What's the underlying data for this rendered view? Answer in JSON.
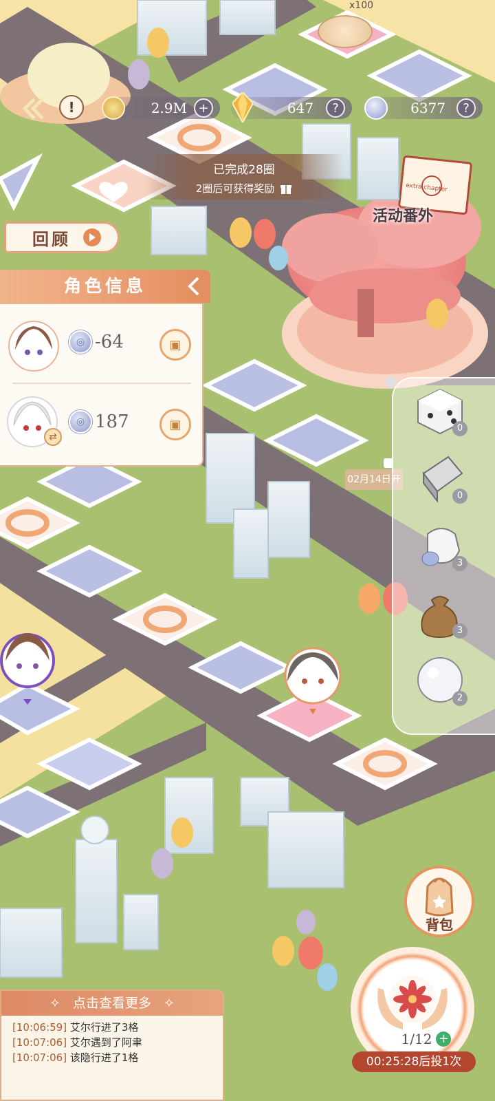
{
  "currencies": {
    "gold": {
      "value": "2.9M",
      "icon": "gold-coin-icon"
    },
    "crystal": {
      "value": "647",
      "icon": "crystal-icon"
    },
    "silver": {
      "value": "6377",
      "icon": "silver-coin-icon"
    },
    "plus_symbol": "+",
    "help_symbol": "?"
  },
  "lap_banner": {
    "completed": "已完成28圈",
    "reward_hint": "2圈后可获得奖励"
  },
  "top_reward_tile": {
    "count": "x100"
  },
  "review_button": {
    "label": "回顾"
  },
  "event_label": "活动番外",
  "event_card_text": "extra chapter",
  "character_panel": {
    "title": "角色信息",
    "rows": [
      {
        "value": "-64",
        "avatar": "brown-hair-girl-avatar"
      },
      {
        "value": "187",
        "avatar": "white-hair-boy-avatar",
        "badge": "swap-icon"
      }
    ]
  },
  "date_lock_label": "02月14日开",
  "tools": [
    {
      "name": "dice",
      "count": "0"
    },
    {
      "name": "remote-control",
      "count": "0"
    },
    {
      "name": "glove",
      "count": "3"
    },
    {
      "name": "money-sack",
      "count": "3"
    },
    {
      "name": "snowball",
      "count": "2"
    }
  ],
  "log_panel": {
    "header": "点击查看更多",
    "lines": [
      {
        "time": "[10:06:59]",
        "text": "艾尔行进了3格"
      },
      {
        "time": "[10:07:06]",
        "text": "艾尔遇到了阿聿"
      },
      {
        "time": "[10:07:06]",
        "text": "该隐行进了1格"
      }
    ]
  },
  "bag_button": {
    "label": "背包"
  },
  "roll": {
    "counter": "1/12",
    "timer": "00:25:28后投1次"
  },
  "colors": {
    "grass": "#a8c070",
    "road": "#7d7175",
    "accent_orange": "#e48d60",
    "timer_red": "#b3462f",
    "tile_blue": "#b9bfe3",
    "tile_pink": "#f6b2c3"
  }
}
